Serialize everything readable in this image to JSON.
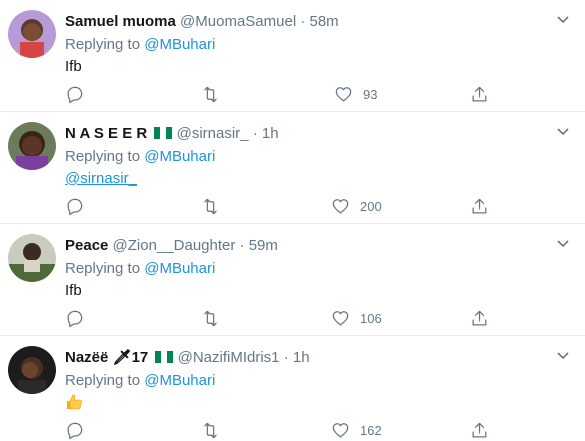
{
  "tweets": [
    {
      "name": "Samuel muoma",
      "handle": "@MuomaSamuel",
      "dot": "·",
      "time": "58m",
      "replying_prefix": "Replying to",
      "replying_to": "@MBuhari",
      "body": "Ifb",
      "likes": "93"
    },
    {
      "name": "N A S E E R",
      "handle": "@sirnasir_",
      "dot": "·",
      "time": "1h",
      "replying_prefix": "Replying to",
      "replying_to": "@MBuhari",
      "body": "@sirnasir_",
      "likes": "200"
    },
    {
      "name": "Peace",
      "handle": "@Zion__Daughter",
      "dot": "·",
      "time": "59m",
      "replying_prefix": "Replying to",
      "replying_to": "@MBuhari",
      "body": "Ifb",
      "likes": "106"
    },
    {
      "name": "Nazëë 🗡17",
      "handle": "@NazifiMIdris1",
      "dot": "·",
      "time": "1h",
      "replying_prefix": "Replying to",
      "replying_to": "@MBuhari",
      "body": "",
      "likes": "162"
    }
  ],
  "colors": {
    "accent": "#1b95e0",
    "muted": "#657786",
    "text": "#14171a",
    "nigeria_green": "#008751"
  },
  "icons": [
    "chevron-down-icon",
    "reply-icon",
    "retweet-icon",
    "like-icon",
    "share-icon",
    "nigeria-flag-icon",
    "thumbs-up-emoji"
  ]
}
